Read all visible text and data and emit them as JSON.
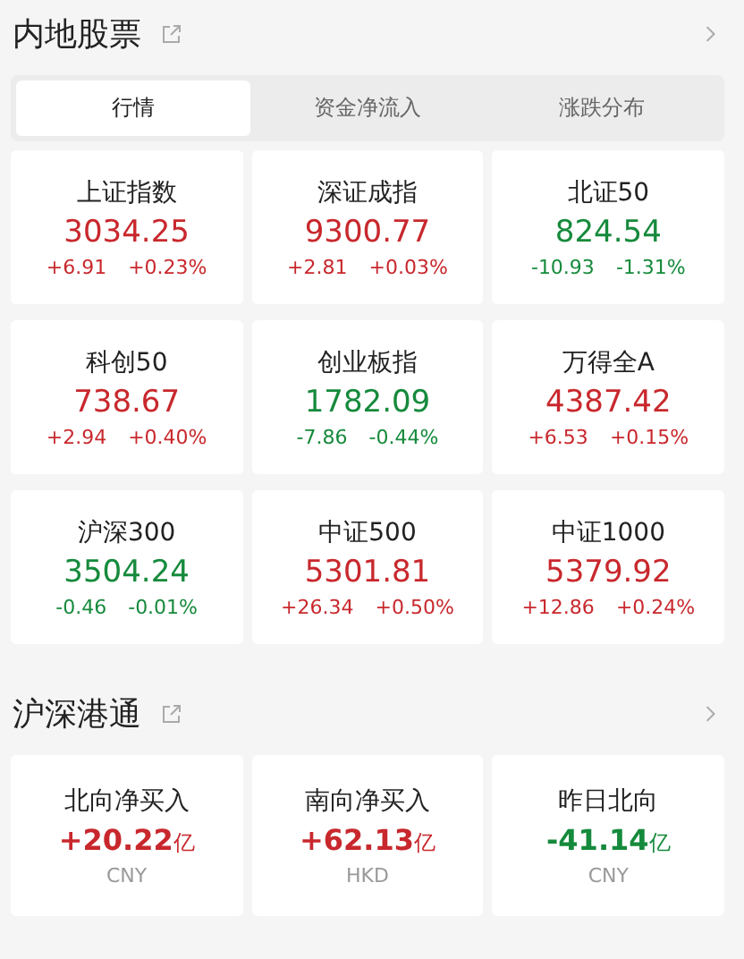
{
  "mainland": {
    "title": "内地股票",
    "tabs": [
      {
        "label": "行情",
        "selected": true
      },
      {
        "label": "资金净流入",
        "selected": false
      },
      {
        "label": "涨跌分布",
        "selected": false
      }
    ],
    "indices": [
      {
        "name": "上证指数",
        "value": "3034.25",
        "change": "+6.91",
        "percent": "+0.23%",
        "color": "#c8282d"
      },
      {
        "name": "深证成指",
        "value": "9300.77",
        "change": "+2.81",
        "percent": "+0.03%",
        "color": "#c8282d"
      },
      {
        "name": "北证50",
        "value": "824.54",
        "change": "-10.93",
        "percent": "-1.31%",
        "color": "#168a3c"
      },
      {
        "name": "科创50",
        "value": "738.67",
        "change": "+2.94",
        "percent": "+0.40%",
        "color": "#c8282d"
      },
      {
        "name": "创业板指",
        "value": "1782.09",
        "change": "-7.86",
        "percent": "-0.44%",
        "color": "#168a3c"
      },
      {
        "name": "万得全A",
        "value": "4387.42",
        "change": "+6.53",
        "percent": "+0.15%",
        "color": "#c8282d"
      },
      {
        "name": "沪深300",
        "value": "3504.24",
        "change": "-0.46",
        "percent": "-0.01%",
        "color": "#168a3c"
      },
      {
        "name": "中证500",
        "value": "5301.81",
        "change": "+26.34",
        "percent": "+0.50%",
        "color": "#c8282d"
      },
      {
        "name": "中证1000",
        "value": "5379.92",
        "change": "+12.86",
        "percent": "+0.24%",
        "color": "#c8282d"
      }
    ]
  },
  "connect": {
    "title": "沪深港通",
    "flows": [
      {
        "name": "北向净买入",
        "value": "+20.22",
        "unit": "亿",
        "currency": "CNY",
        "color": "#c8282d"
      },
      {
        "name": "南向净买入",
        "value": "+62.13",
        "unit": "亿",
        "currency": "HKD",
        "color": "#c8282d"
      },
      {
        "name": "昨日北向",
        "value": "-41.14",
        "unit": "亿",
        "currency": "CNY",
        "color": "#168a3c"
      }
    ]
  }
}
